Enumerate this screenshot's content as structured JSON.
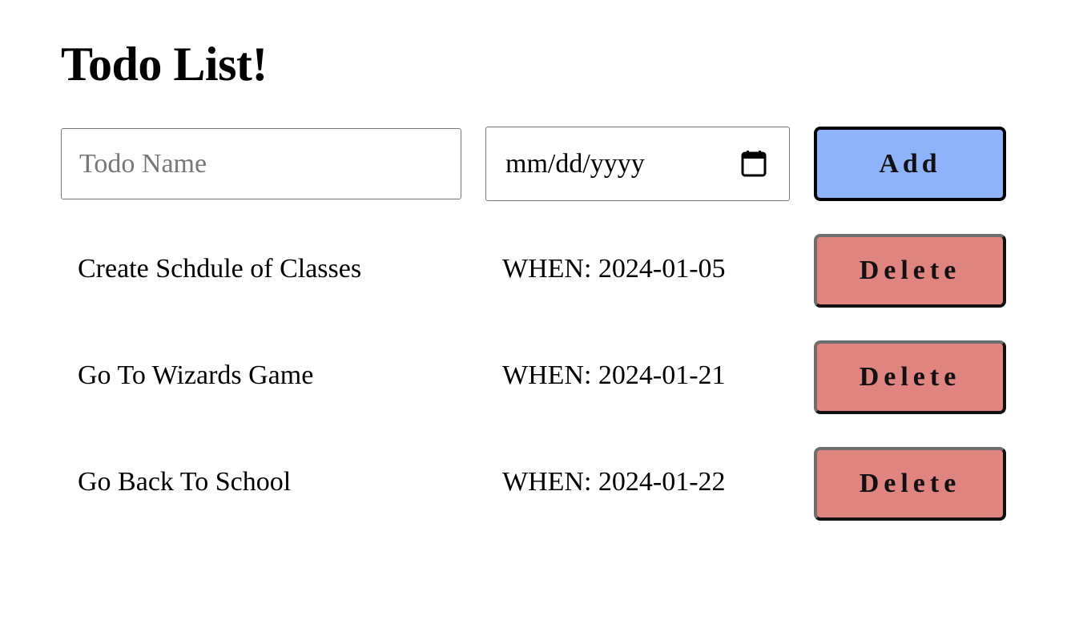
{
  "header": {
    "title": "Todo List!"
  },
  "form": {
    "name_placeholder": "Todo Name",
    "name_value": "",
    "date_placeholder": "mm/dd/yyyy",
    "add_label": "Add",
    "add_color": "#8fb3fa"
  },
  "todos": [
    {
      "name": "Create Schdule of Classes",
      "when": "WHEN: 2024-01-05",
      "delete_label": "Delete"
    },
    {
      "name": "Go To Wizards Game",
      "when": "WHEN: 2024-01-21",
      "delete_label": "Delete"
    },
    {
      "name": "Go Back To School",
      "when": "WHEN: 2024-01-22",
      "delete_label": "Delete"
    }
  ],
  "colors": {
    "delete": "#e08480"
  },
  "icons": {
    "date_picker": "calendar-icon"
  }
}
